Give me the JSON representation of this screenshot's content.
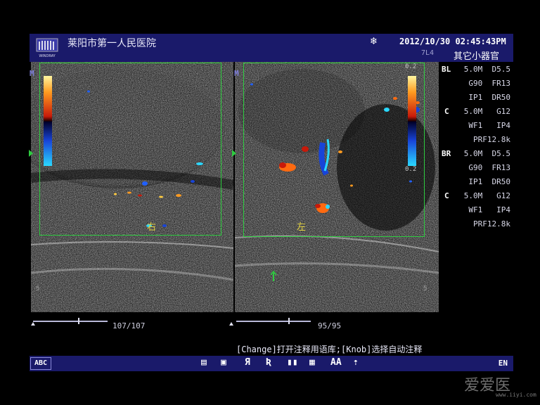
{
  "header": {
    "logo_text": "WINDRAY",
    "hospital": "莱阳市第一人民医院",
    "snowflake_glyph": "❄",
    "datetime": "2012/10/30  02:45:43PM",
    "probe": "7L4",
    "preset": "其它小器官"
  },
  "params_left": {
    "label_bmode": "BL",
    "bmode_line1": "5.0M  D5.5",
    "bmode_line2": "G90  FR13",
    "bmode_line3": "IP1  DR50",
    "label_color": "C",
    "color_line1": "5.0M   G12",
    "color_line2": "WF1   IP4",
    "color_line3": "PRF12.8k"
  },
  "params_right": {
    "label_bmode": "BR",
    "bmode_line1": "5.0M  D5.5",
    "bmode_line2": "G90  FR13",
    "bmode_line3": "IP1  DR50",
    "label_color": "C",
    "color_line1": "5.0M   G12",
    "color_line2": "WF1   IP4",
    "color_line3": "PRF12.8k"
  },
  "left_image": {
    "orientation_marker": "M",
    "annotation": "右",
    "depth_label": "5",
    "color_scale_top": "",
    "color_scale_bottom": ""
  },
  "right_image": {
    "orientation_marker": "M",
    "annotation": "左",
    "depth_label": "5",
    "color_scale_top": "0.2",
    "color_scale_bottom": "0.2"
  },
  "cine_left": {
    "count": "107/107",
    "position": 0.6
  },
  "cine_right": {
    "count": "95/95",
    "position": 0.7
  },
  "hint": "[Change]打开注释用语库;[Knob]选择自动注释",
  "toolbar": {
    "abc_label": "ABC",
    "tools": [
      "▤",
      "▣",
      "Я",
      "Ʀ",
      "▮▮",
      "▦",
      "AA",
      "⇡"
    ],
    "lang": "EN"
  },
  "watermark": {
    "text": "爱爱医",
    "url": "www.iiyi.com"
  }
}
